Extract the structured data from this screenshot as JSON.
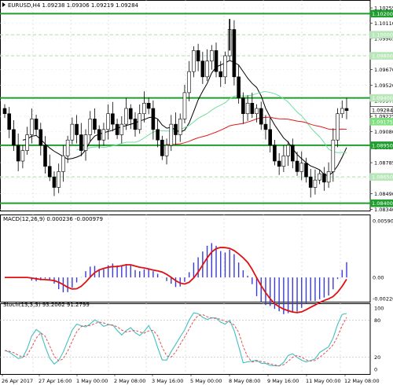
{
  "main_panel": {
    "symbol_header": "EURUSD,H4 1.09238 1.09306 1.09219 1.09284",
    "price_scale": [
      "1.10255",
      "1.10110",
      "1.09965",
      "1.09815",
      "1.09670",
      "1.09520",
      "1.09375",
      "1.09225",
      "1.09080",
      "1.08930",
      "1.08785",
      "1.08635",
      "1.08490",
      "1.08340"
    ],
    "price_tags": [
      {
        "text": "1.10200",
        "bg": "#1f9d2e",
        "fg": "#ffffff"
      },
      {
        "text": "1.10000",
        "bg": "#b8e6b8",
        "fg": "#ffffff"
      },
      {
        "text": "1.09800",
        "bg": "#b8e6b8",
        "fg": "#ffffff"
      },
      {
        "text": "1.09400",
        "bg": "#b8e6b8",
        "fg": "#ffffff"
      },
      {
        "text": "1.09284",
        "bg": "#ffffff",
        "fg": "#000000"
      },
      {
        "text": "1.09175",
        "bg": "#7ee07e",
        "fg": "#ffffff"
      },
      {
        "text": "1.08950",
        "bg": "#1f9d2e",
        "fg": "#ffffff"
      },
      {
        "text": "1.08650",
        "bg": "#b8e6b8",
        "fg": "#ffffff"
      },
      {
        "text": "1.08400",
        "bg": "#1f9d2e",
        "fg": "#ffffff"
      }
    ]
  },
  "macd_panel": {
    "label": "MACD(12,26,9) 0.000236 -0.000979",
    "scale": [
      "0.005901",
      "0.00",
      "-0.002202"
    ]
  },
  "stoch_panel": {
    "label": "Stoch(13,3,3) 93.2062 91.2799",
    "scale": [
      "100",
      "80",
      "20",
      "0"
    ]
  },
  "time_axis": [
    "26 Apr 2017",
    "27 Apr 16:00",
    "1 May 00:00",
    "2 May 08:00",
    "3 May 16:00",
    "5 May 00:00",
    "8 May 08:00",
    "9 May 16:00",
    "11 May 00:00",
    "12 May 08:00"
  ],
  "colors": {
    "support_line": "#1f9d2e",
    "light_line": "#b8e6b8",
    "candle": "#000000",
    "ma_black": "#000000",
    "ma_green": "#6fe0a0",
    "ma_red": "#e01a1a",
    "macd_hist": "#3a3ad8",
    "macd_signal": "#e01010",
    "stoch_main": "#40c0c0",
    "stoch_signal": "#e05050"
  },
  "chart_data": {
    "type": "candlestick",
    "symbol": "EURUSD",
    "timeframe": "H4",
    "last": {
      "open": 1.09238,
      "high": 1.09306,
      "low": 1.09219,
      "close": 1.09284
    },
    "horizontal_levels": [
      1.102,
      1.1,
      1.098,
      1.094,
      1.0895,
      1.0865,
      1.084
    ],
    "close_series": [
      1.0925,
      1.091,
      1.0895,
      1.088,
      1.089,
      1.0905,
      1.092,
      1.091,
      1.0895,
      1.0875,
      1.0865,
      1.0855,
      1.087,
      1.0885,
      1.09,
      1.0915,
      1.0905,
      1.089,
      1.0905,
      1.092,
      1.091,
      1.09,
      1.091,
      1.0925,
      1.0915,
      1.0905,
      1.0915,
      1.093,
      1.092,
      1.091,
      1.0925,
      1.0935,
      1.093,
      1.091,
      1.09,
      1.0885,
      1.0895,
      1.0915,
      1.0905,
      1.092,
      1.0945,
      1.0965,
      1.0985,
      1.0975,
      1.096,
      1.0975,
      1.0985,
      1.0965,
      1.096,
      1.098,
      1.1005,
      1.096,
      1.094,
      1.0925,
      1.0935,
      1.0925,
      1.093,
      1.0915,
      1.091,
      1.0895,
      1.088,
      1.0875,
      1.0885,
      1.0895,
      1.088,
      1.087,
      1.0878,
      1.0865,
      1.0855,
      1.0862,
      1.0868,
      1.086,
      1.087,
      1.09,
      1.0925,
      1.093,
      1.0928
    ],
    "macd_hist_range": [
      -0.002202,
      0.005901
    ],
    "stoch_range": [
      0,
      100
    ]
  }
}
